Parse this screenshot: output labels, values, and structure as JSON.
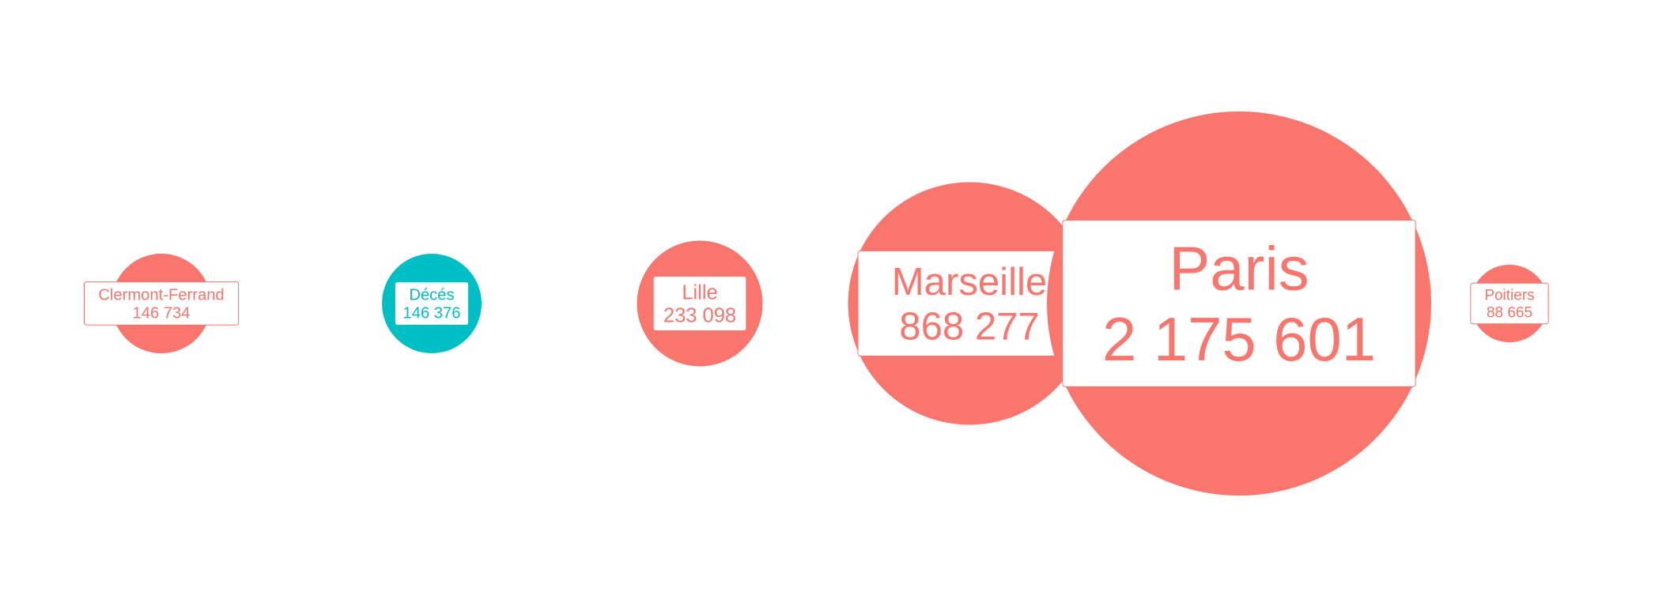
{
  "chart_data": {
    "type": "bubble",
    "title": "",
    "xlabel": "",
    "ylabel": "",
    "grid": false,
    "legend": "none",
    "series_colors": {
      "default": "#F8766D",
      "highlight": "#00BFC4"
    },
    "bubbles": [
      {
        "name": "Clermont-Ferrand",
        "label": "146 734",
        "value": 146734,
        "color": "#F8766D"
      },
      {
        "name": "Décés",
        "label": "146 376",
        "value": 146376,
        "color": "#00BFC4"
      },
      {
        "name": "Lille",
        "label": "233 098",
        "value": 233098,
        "color": "#F8766D"
      },
      {
        "name": "Marseille",
        "label": "868 277",
        "value": 868277,
        "color": "#F8766D"
      },
      {
        "name": "Paris",
        "label": "2 175 601",
        "value": 2175601,
        "color": "#F8766D"
      },
      {
        "name": "Poitiers",
        "label": "88 665",
        "value": 88665,
        "color": "#F8766D"
      }
    ]
  }
}
